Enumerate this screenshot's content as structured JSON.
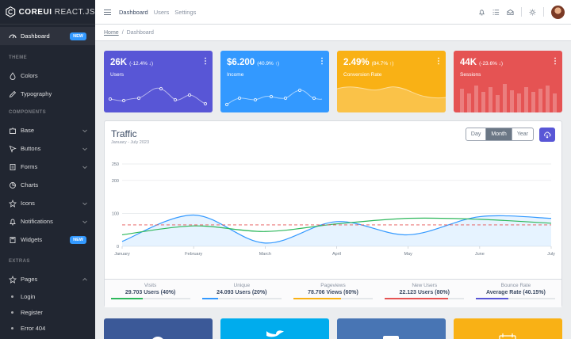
{
  "brand": {
    "name": "COREUI",
    "suffix": "REACT.JS"
  },
  "sidebar": {
    "dashboard": {
      "label": "Dashboard",
      "badge": "NEW"
    },
    "sections": {
      "theme": "THEME",
      "components": "COMPONENTS",
      "extras": "EXTRAS"
    },
    "theme_items": [
      {
        "label": "Colors",
        "icon": "drop-icon"
      },
      {
        "label": "Typography",
        "icon": "pencil-icon"
      }
    ],
    "component_items": [
      {
        "label": "Base",
        "icon": "puzzle-icon"
      },
      {
        "label": "Buttons",
        "icon": "cursor-icon"
      },
      {
        "label": "Forms",
        "icon": "notes-icon"
      },
      {
        "label": "Charts",
        "icon": "chart-pie-icon"
      },
      {
        "label": "Icons",
        "icon": "star-icon"
      },
      {
        "label": "Notifications",
        "icon": "bell-icon"
      }
    ],
    "widgets": {
      "label": "Widgets",
      "badge": "NEW"
    },
    "extra_items": [
      {
        "label": "Pages",
        "icon": "star-icon"
      },
      {
        "label": "Login"
      },
      {
        "label": "Register"
      },
      {
        "label": "Error 404"
      }
    ]
  },
  "header": {
    "links": [
      "Dashboard",
      "Users",
      "Settings"
    ]
  },
  "breadcrumb": {
    "home": "Home",
    "separator": "/",
    "current": "Dashboard"
  },
  "widgets": [
    {
      "value": "26K",
      "change": "(-12.4% ↓)",
      "label": "Users",
      "color": "#5856d6"
    },
    {
      "value": "$6.200",
      "change": "(40.9% ↑)",
      "label": "Income",
      "color": "#3399ff"
    },
    {
      "value": "2.49%",
      "change": "(84.7% ↑)",
      "label": "Conversion Rate",
      "color": "#f9b115"
    },
    {
      "value": "44K",
      "change": "(-23.6% ↓)",
      "label": "Sessions",
      "color": "#e55353"
    }
  ],
  "traffic": {
    "title": "Traffic",
    "subtitle": "January - July 2023",
    "ranges": [
      "Day",
      "Month",
      "Year"
    ],
    "active_range": "Month",
    "stats": [
      {
        "title": "Visits",
        "value": "29.703 Users (40%)",
        "percent": 40,
        "color": "#2eb85c"
      },
      {
        "title": "Unique",
        "value": "24.093 Users (20%)",
        "percent": 20,
        "color": "#39f"
      },
      {
        "title": "Pageviews",
        "value": "78.706 Views (60%)",
        "percent": 60,
        "color": "#f9b115"
      },
      {
        "title": "New Users",
        "value": "22.123 Users (80%)",
        "percent": 80,
        "color": "#e55353"
      },
      {
        "title": "Bounce Rate",
        "value": "Average Rate (40.15%)",
        "percent": 40.15,
        "color": "#5856d6"
      }
    ]
  },
  "chart_data": {
    "type": "line",
    "categories": [
      "January",
      "February",
      "March",
      "April",
      "May",
      "June",
      "July"
    ],
    "ylim": [
      0,
      250
    ],
    "yticks": [
      0,
      100,
      200,
      250
    ],
    "series": [
      {
        "values": [
          15,
          95,
          10,
          75,
          35,
          90,
          85
        ],
        "color": "#39f",
        "fill": true
      },
      {
        "values": [
          35,
          62,
          45,
          68,
          85,
          82,
          70
        ],
        "color": "#2eb85c"
      },
      {
        "values": [
          65,
          65,
          65,
          65,
          65,
          65,
          65
        ],
        "color": "#e55353",
        "dashed": true
      }
    ]
  },
  "social_colors": [
    "#3b5998",
    "#00aced",
    "#4875b4",
    "#f9b115"
  ]
}
